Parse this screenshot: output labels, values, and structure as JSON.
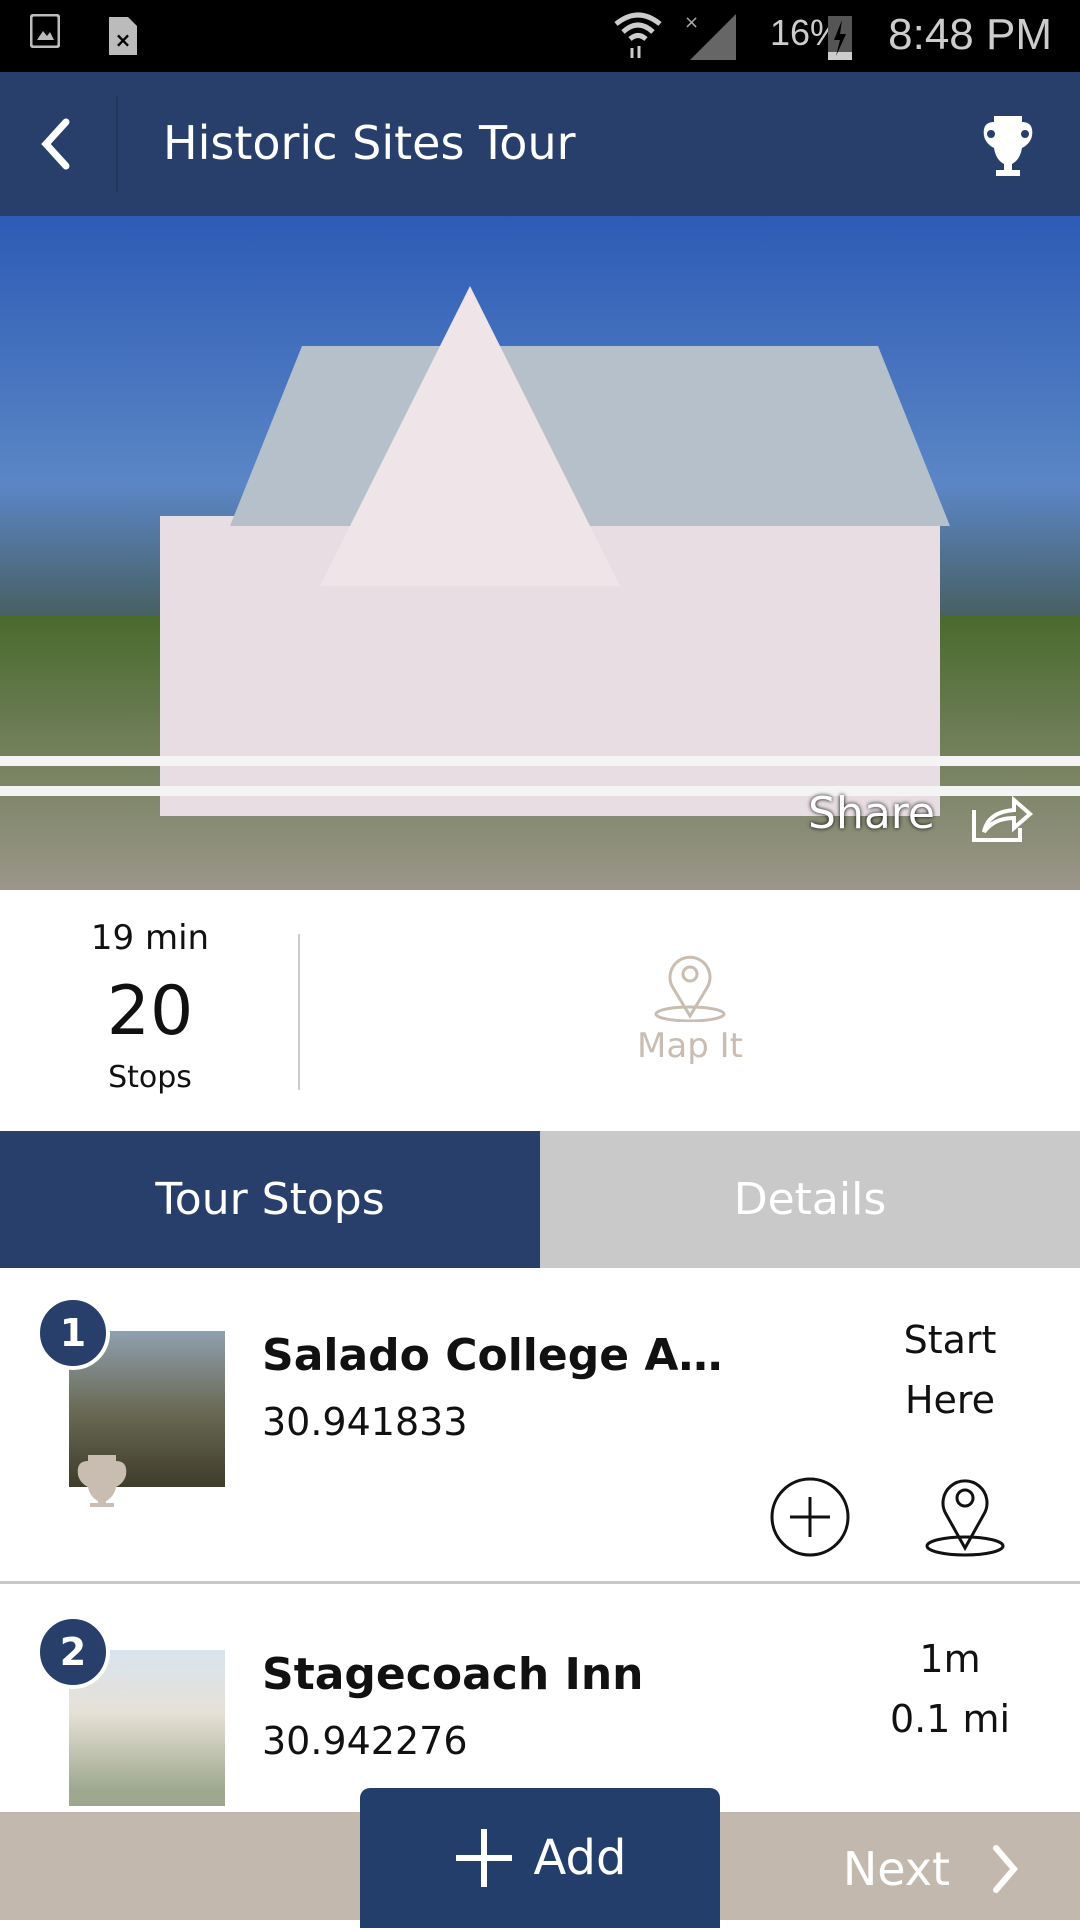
{
  "status_bar": {
    "battery": "16%",
    "time": "8:48 PM"
  },
  "header": {
    "title": "Historic Sites Tour",
    "back_icon": "chevron-left-icon",
    "action_icon": "amphora-icon"
  },
  "hero": {
    "share_label": "Share"
  },
  "stats": {
    "duration": "19 min",
    "stops_count": "20",
    "stops_label": "Stops",
    "map_label": "Map It"
  },
  "tabs": [
    {
      "label": "Tour Stops",
      "active": true
    },
    {
      "label": "Details",
      "active": false
    }
  ],
  "stops": [
    {
      "number": "1",
      "name": "Salado College Arc...",
      "coord": "30.941833",
      "meta1": "Start",
      "meta2": "Here"
    },
    {
      "number": "2",
      "name": "Stagecoach Inn",
      "coord": "30.942276",
      "meta1": "1m",
      "meta2": "0.1 mi"
    }
  ],
  "bottom": {
    "add_label": "Add",
    "next_label": "Next"
  },
  "colors": {
    "primary": "#283f6b",
    "inactive_tab": "#c9c9c9",
    "bottom_bar": "#c3b8ad",
    "accent_icon": "#c9bdb2"
  }
}
